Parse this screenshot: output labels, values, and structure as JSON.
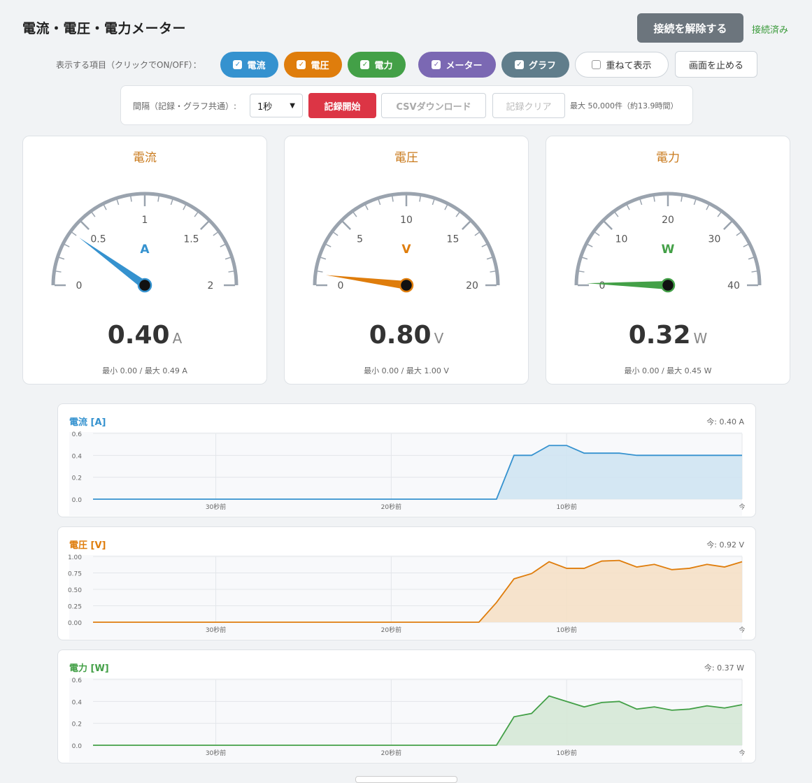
{
  "header": {
    "title": "電流・電圧・電力メーター",
    "disconnect_label": "接続を解除する",
    "status": "接続済み"
  },
  "toggles": {
    "label": "表示する項目（クリックでON/OFF）：",
    "items": [
      {
        "label": "電流",
        "checked": true,
        "color": "#3592cf"
      },
      {
        "label": "電圧",
        "checked": true,
        "color": "#df7d0c"
      },
      {
        "label": "電力",
        "checked": true,
        "color": "#43a047"
      },
      {
        "label": "メーター",
        "checked": true,
        "color": "#7b68b3"
      },
      {
        "label": "グラフ",
        "checked": true,
        "color": "#607d8b"
      },
      {
        "label": "重ねて表示",
        "checked": false,
        "color": "#ffffff"
      }
    ],
    "stop_label": "画面を止める"
  },
  "recording": {
    "interval_label": "間隔（記録・グラフ共通）:",
    "interval_value": "1秒",
    "start_label": "記録開始",
    "csv_label": "CSVダウンロード",
    "clear_label": "記録クリア",
    "max_note": "最大 50,000件（約13.9時間）"
  },
  "meters": [
    {
      "title": "電流",
      "unit": "A",
      "value": "0.40",
      "value_num": 0.4,
      "min_label": "0",
      "max_scale": 2,
      "ticks": [
        "0",
        "0.5",
        "1",
        "1.5",
        "2"
      ],
      "minmax": "最小 0.00 / 最大 0.49 A",
      "color": "#3592cf",
      "title_color": "#c97a1c"
    },
    {
      "title": "電圧",
      "unit": "V",
      "value": "0.80",
      "value_num": 0.8,
      "max_scale": 20,
      "ticks": [
        "0",
        "5",
        "10",
        "15",
        "20"
      ],
      "minmax": "最小 0.00 / 最大 1.00 V",
      "color": "#df7d0c",
      "title_color": "#c97a1c"
    },
    {
      "title": "電力",
      "unit": "W",
      "value": "0.32",
      "value_num": 0.32,
      "max_scale": 40,
      "ticks": [
        "0",
        "10",
        "20",
        "30",
        "40"
      ],
      "minmax": "最小 0.00 / 最大 0.45 W",
      "color": "#43a047",
      "title_color": "#c97a1c"
    }
  ],
  "chart_data": [
    {
      "type": "area",
      "title": "電流 [A]",
      "now_label": "今: 0.40 A",
      "color": "#3592cf",
      "fill": "#cfe4f2",
      "ylim": [
        0,
        0.6
      ],
      "yticks": [
        "0.0",
        "0.2",
        "0.4",
        "0.6"
      ],
      "ytick_values": [
        0,
        0.2,
        0.4,
        0.6
      ],
      "xlim": [
        -37,
        0
      ],
      "xticks": [
        "30秒前",
        "20秒前",
        "10秒前",
        "今"
      ],
      "xtick_values": [
        -30,
        -20,
        -10,
        0
      ],
      "x": [
        -37,
        -14,
        -13,
        -12,
        -11,
        -10,
        -9,
        -8,
        -7,
        -6,
        -5,
        -4,
        -3,
        -2,
        -1,
        0
      ],
      "y": [
        0,
        0,
        0.4,
        0.4,
        0.49,
        0.49,
        0.42,
        0.42,
        0.42,
        0.4,
        0.4,
        0.4,
        0.4,
        0.4,
        0.4,
        0.4
      ]
    },
    {
      "type": "area",
      "title": "電圧 [V]",
      "now_label": "今: 0.92 V",
      "color": "#df7d0c",
      "fill": "#f5e0c7",
      "ylim": [
        0,
        1.0
      ],
      "yticks": [
        "0.00",
        "0.25",
        "0.50",
        "0.75",
        "1.00"
      ],
      "ytick_values": [
        0,
        0.25,
        0.5,
        0.75,
        1.0
      ],
      "xlim": [
        -37,
        0
      ],
      "xticks": [
        "30秒前",
        "20秒前",
        "10秒前",
        "今"
      ],
      "xtick_values": [
        -30,
        -20,
        -10,
        0
      ],
      "x": [
        -37,
        -15,
        -14,
        -13,
        -12,
        -11,
        -10,
        -9,
        -8,
        -7,
        -6,
        -5,
        -4,
        -3,
        -2,
        -1,
        0
      ],
      "y": [
        0,
        0,
        0.3,
        0.66,
        0.74,
        0.92,
        0.82,
        0.82,
        0.93,
        0.94,
        0.84,
        0.88,
        0.8,
        0.82,
        0.88,
        0.84,
        0.92
      ]
    },
    {
      "type": "area",
      "title": "電力 [W]",
      "now_label": "今: 0.37 W",
      "color": "#43a047",
      "fill": "#d5e8d6",
      "ylim": [
        0,
        0.6
      ],
      "yticks": [
        "0.0",
        "0.2",
        "0.4",
        "0.6"
      ],
      "ytick_values": [
        0,
        0.2,
        0.4,
        0.6
      ],
      "xlim": [
        -37,
        0
      ],
      "xticks": [
        "30秒前",
        "20秒前",
        "10秒前",
        "今"
      ],
      "xtick_values": [
        -30,
        -20,
        -10,
        0
      ],
      "x": [
        -37,
        -14,
        -13,
        -12,
        -11,
        -10,
        -9,
        -8,
        -7,
        -6,
        -5,
        -4,
        -3,
        -2,
        -1,
        0
      ],
      "y": [
        0,
        0,
        0.26,
        0.29,
        0.45,
        0.4,
        0.35,
        0.39,
        0.4,
        0.33,
        0.35,
        0.32,
        0.33,
        0.36,
        0.34,
        0.37
      ]
    }
  ]
}
